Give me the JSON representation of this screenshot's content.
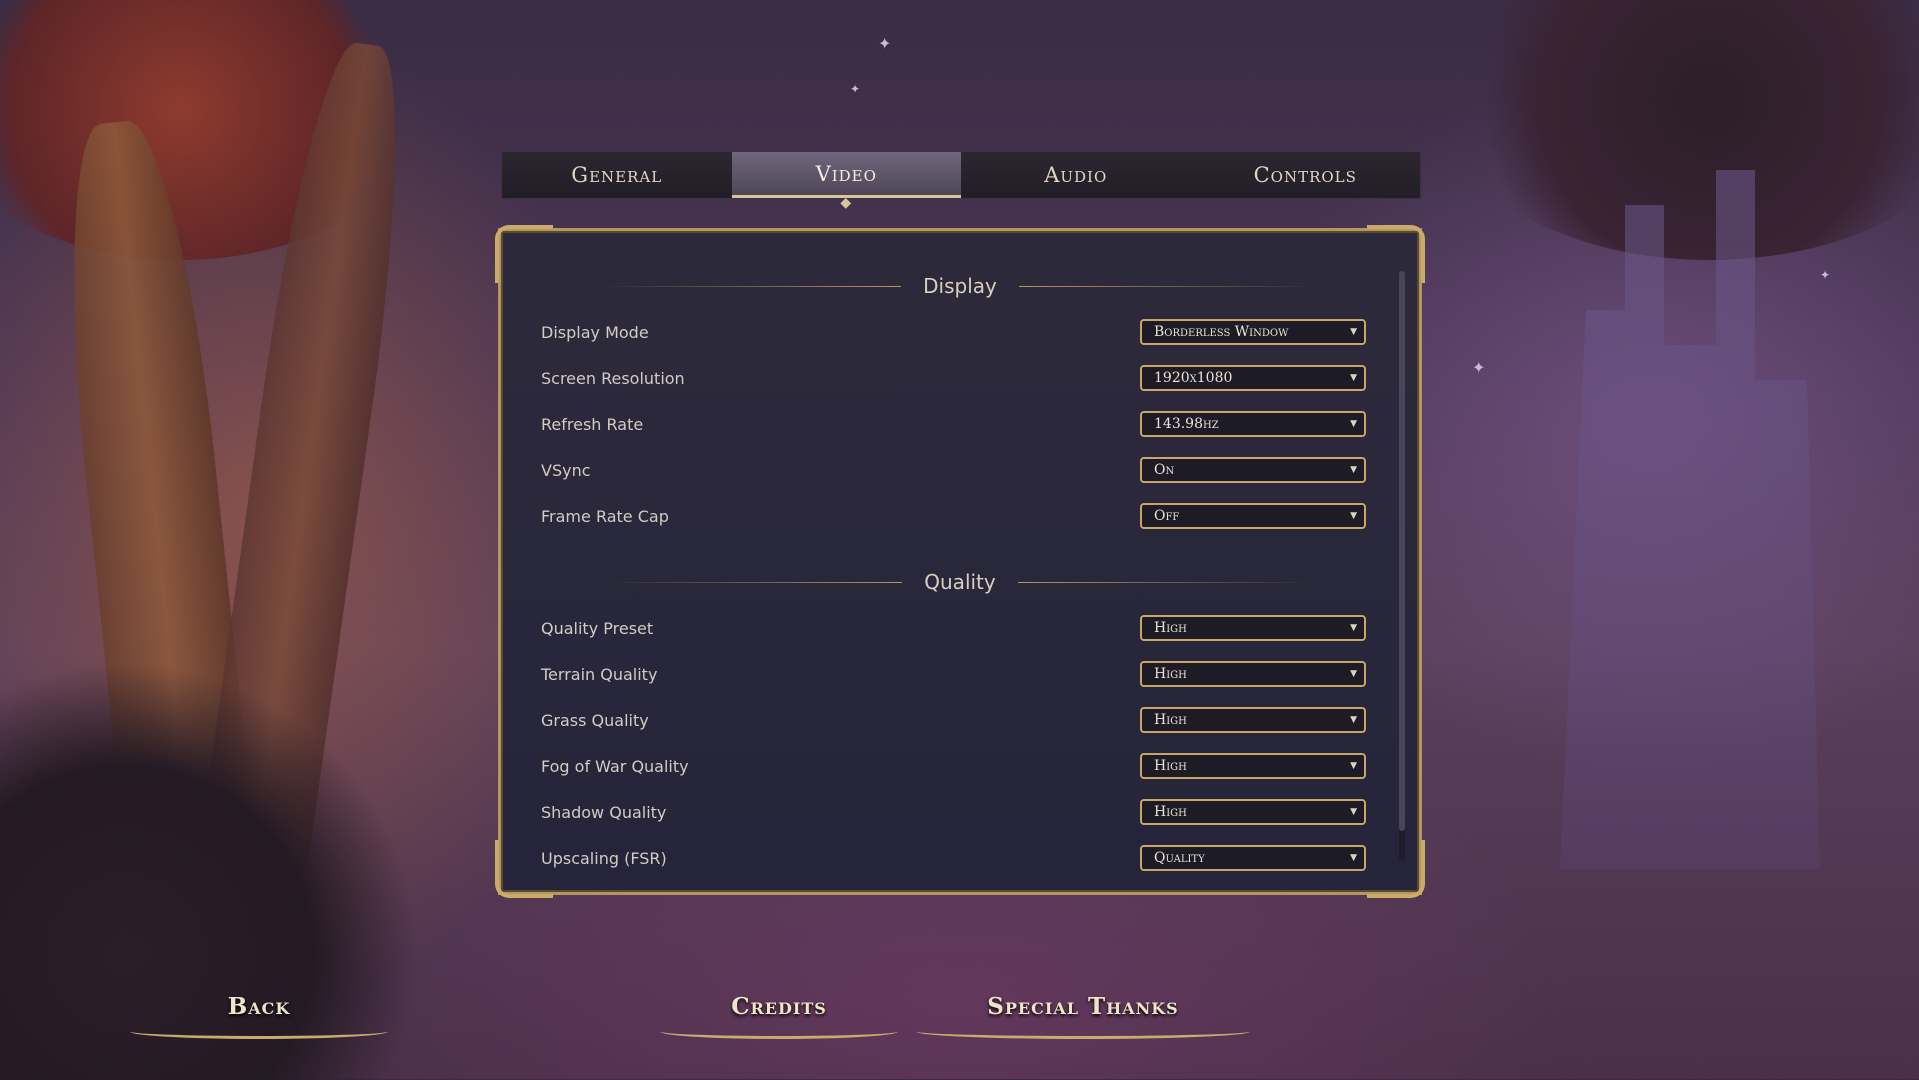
{
  "tabs": [
    {
      "label": "General",
      "active": false
    },
    {
      "label": "Video",
      "active": true
    },
    {
      "label": "Audio",
      "active": false
    },
    {
      "label": "Controls",
      "active": false
    }
  ],
  "sections": {
    "display": {
      "title": "Display",
      "rows": [
        {
          "label": "Display Mode",
          "value": "Borderless Window"
        },
        {
          "label": "Screen Resolution",
          "value": "1920x1080"
        },
        {
          "label": "Refresh Rate",
          "value": "143.98hz"
        },
        {
          "label": "VSync",
          "value": "On"
        },
        {
          "label": "Frame Rate Cap",
          "value": "Off"
        }
      ]
    },
    "quality": {
      "title": "Quality",
      "rows": [
        {
          "label": "Quality Preset",
          "value": "High"
        },
        {
          "label": "Terrain Quality",
          "value": "High"
        },
        {
          "label": "Grass Quality",
          "value": "High"
        },
        {
          "label": "Fog of War Quality",
          "value": "High"
        },
        {
          "label": "Shadow Quality",
          "value": "High"
        },
        {
          "label": "Upscaling (FSR)",
          "value": "Quality"
        }
      ]
    }
  },
  "nav": {
    "back": "Back",
    "credits": "Credits",
    "special_thanks": "Special Thanks"
  },
  "colors": {
    "accent_gold": "#c6a767",
    "panel_bg": "#26243a",
    "text": "#d4cbc4"
  }
}
